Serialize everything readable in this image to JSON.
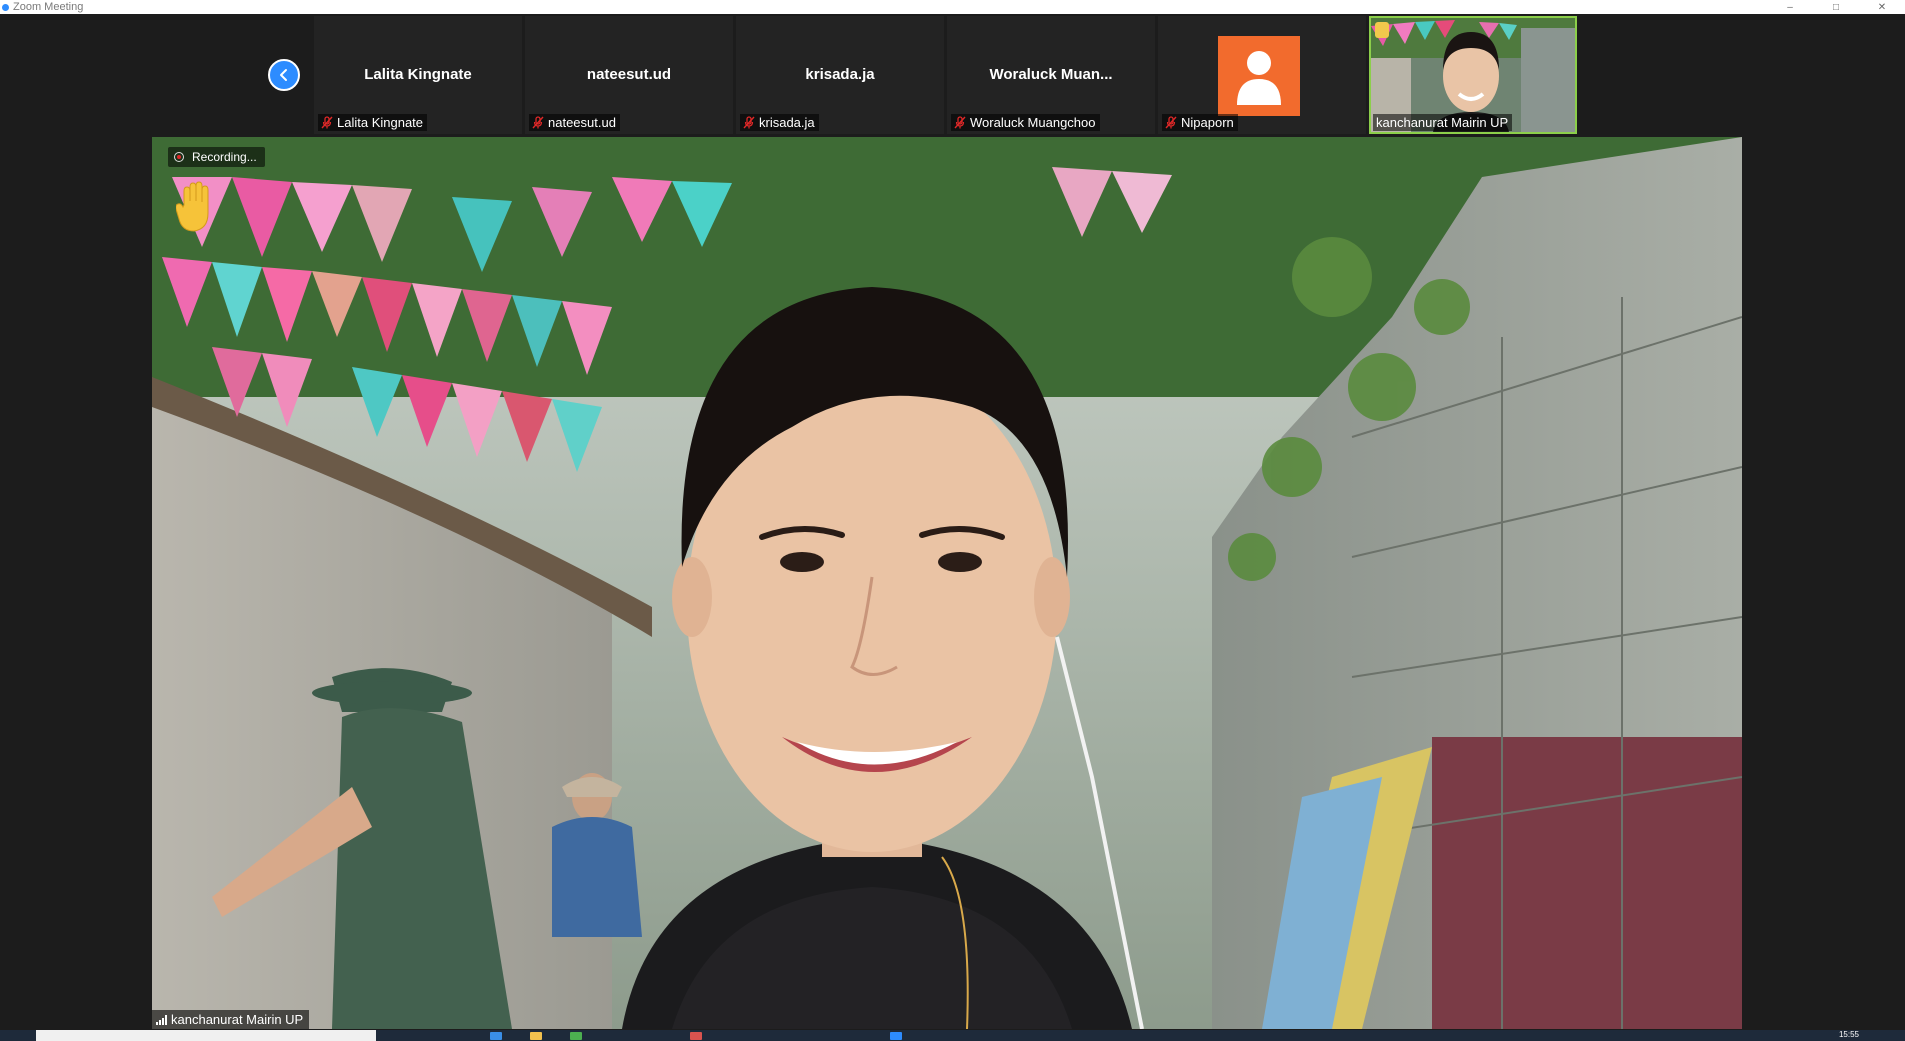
{
  "window": {
    "title": "Zoom Meeting",
    "controls": [
      "minimize",
      "maximize",
      "close"
    ]
  },
  "gallery": {
    "prev_icon": "chevron-left-icon",
    "tiles": [
      {
        "display_name": "Lalita Kingnate",
        "tag": "Lalita Kingnate",
        "muted": true
      },
      {
        "display_name": "nateesut.ud",
        "tag": "nateesut.ud",
        "muted": true
      },
      {
        "display_name": "krisada.ja",
        "tag": "krisada.ja",
        "muted": true
      },
      {
        "display_name": "Woraluck  Muan...",
        "tag": "Woraluck Muangchoo",
        "muted": true
      },
      {
        "display_name": "",
        "tag": "Nipaporn",
        "muted": true,
        "avatar": "person-silhouette-icon",
        "avatar_color": "#f26b2d"
      },
      {
        "display_name": "",
        "tag": "kanchanurat Mairin UP",
        "muted": false,
        "video": true,
        "active_speaker": true
      }
    ]
  },
  "main_video": {
    "recording_label": "Recording...",
    "reaction": "raised-hand",
    "speaker_name": "kanchanurat Mairin UP"
  },
  "taskbar": {
    "clock": "15:55"
  },
  "colors": {
    "accent": "#2d8cff",
    "active_speaker_border": "#8ccf4a",
    "avatar_bg": "#f26b2d",
    "mute_red": "#e02828"
  }
}
